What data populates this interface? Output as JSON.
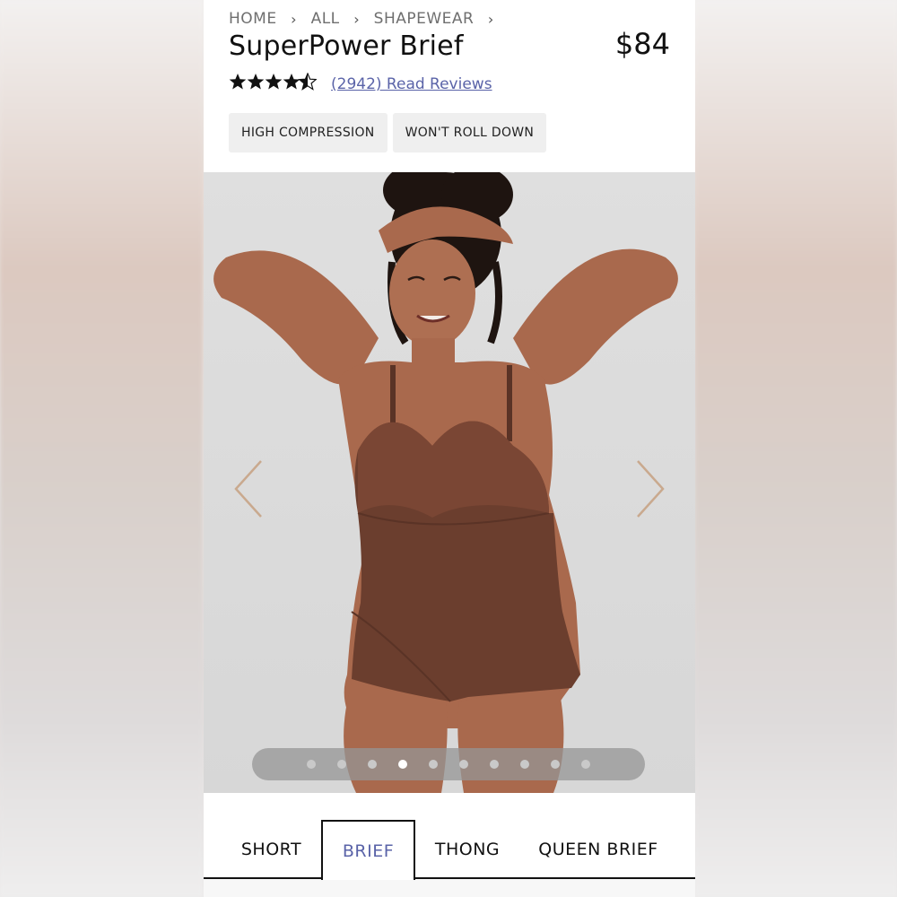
{
  "breadcrumb": {
    "items": [
      "HOME",
      "ALL",
      "SHAPEWEAR"
    ],
    "separator": "›"
  },
  "product": {
    "title": "SuperPower Brief",
    "price": "$84",
    "rating": 4.5,
    "stars": "★★★★☆",
    "reviews_link": "(2942) Read Reviews"
  },
  "tags": [
    "HIGH COMPRESSION",
    "WON'T ROLL DOWN"
  ],
  "gallery": {
    "image_count": 10,
    "active_index": 3,
    "prev_icon": "chevron-left-icon",
    "next_icon": "chevron-right-icon"
  },
  "style_tabs": {
    "items": [
      "SHORT",
      "BRIEF",
      "THONG",
      "QUEEN BRIEF"
    ],
    "active": "BRIEF"
  },
  "colors": {
    "accent": "#5a63a8",
    "garment": "#6b3e2e",
    "skin": "#a9694d",
    "arrow": "#c9a98e"
  }
}
